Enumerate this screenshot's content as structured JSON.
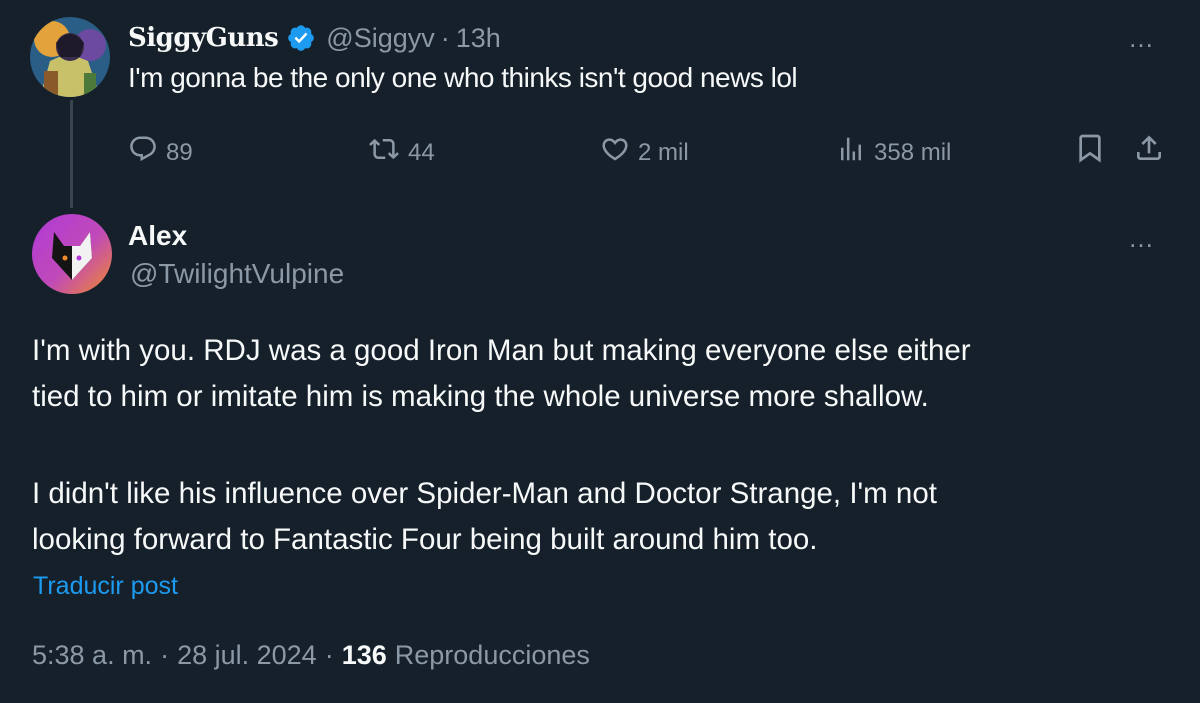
{
  "parent_tweet": {
    "display_name": "SiggyGuns",
    "handle": "@Siggyv",
    "time": "13h",
    "text": "I'm gonna be the only one who thinks isn't good news lol",
    "more_icon": "…",
    "stats": {
      "replies": "89",
      "retweets": "44",
      "likes": "2 mil",
      "views": "358 mil"
    }
  },
  "reply_tweet": {
    "display_name": "Alex",
    "handle": "@TwilightVulpine",
    "more_icon": "…",
    "paragraphs": [
      [
        "I'm with you. RDJ was a good Iron Man but making everyone else either",
        "tied to him or imitate him is making the whole universe more shallow."
      ],
      [
        "I didn't like his influence over Spider-Man and Doctor Strange, I'm not",
        "looking forward to Fantastic Four being built around him too."
      ]
    ],
    "translate_label": "Traducir post",
    "timestamp": "5:38 a. m.",
    "date": "28 jul. 2024",
    "views_count": "136",
    "views_label": "Reproducciones"
  },
  "colors": {
    "background": "#15202b",
    "text_primary": "#f7f9f9",
    "text_secondary": "#8b98a5",
    "accent": "#1d9bf0"
  },
  "icons": [
    "reply-icon",
    "retweet-icon",
    "like-icon",
    "views-icon",
    "bookmark-icon",
    "share-icon",
    "verified-badge-icon",
    "more-icon"
  ]
}
